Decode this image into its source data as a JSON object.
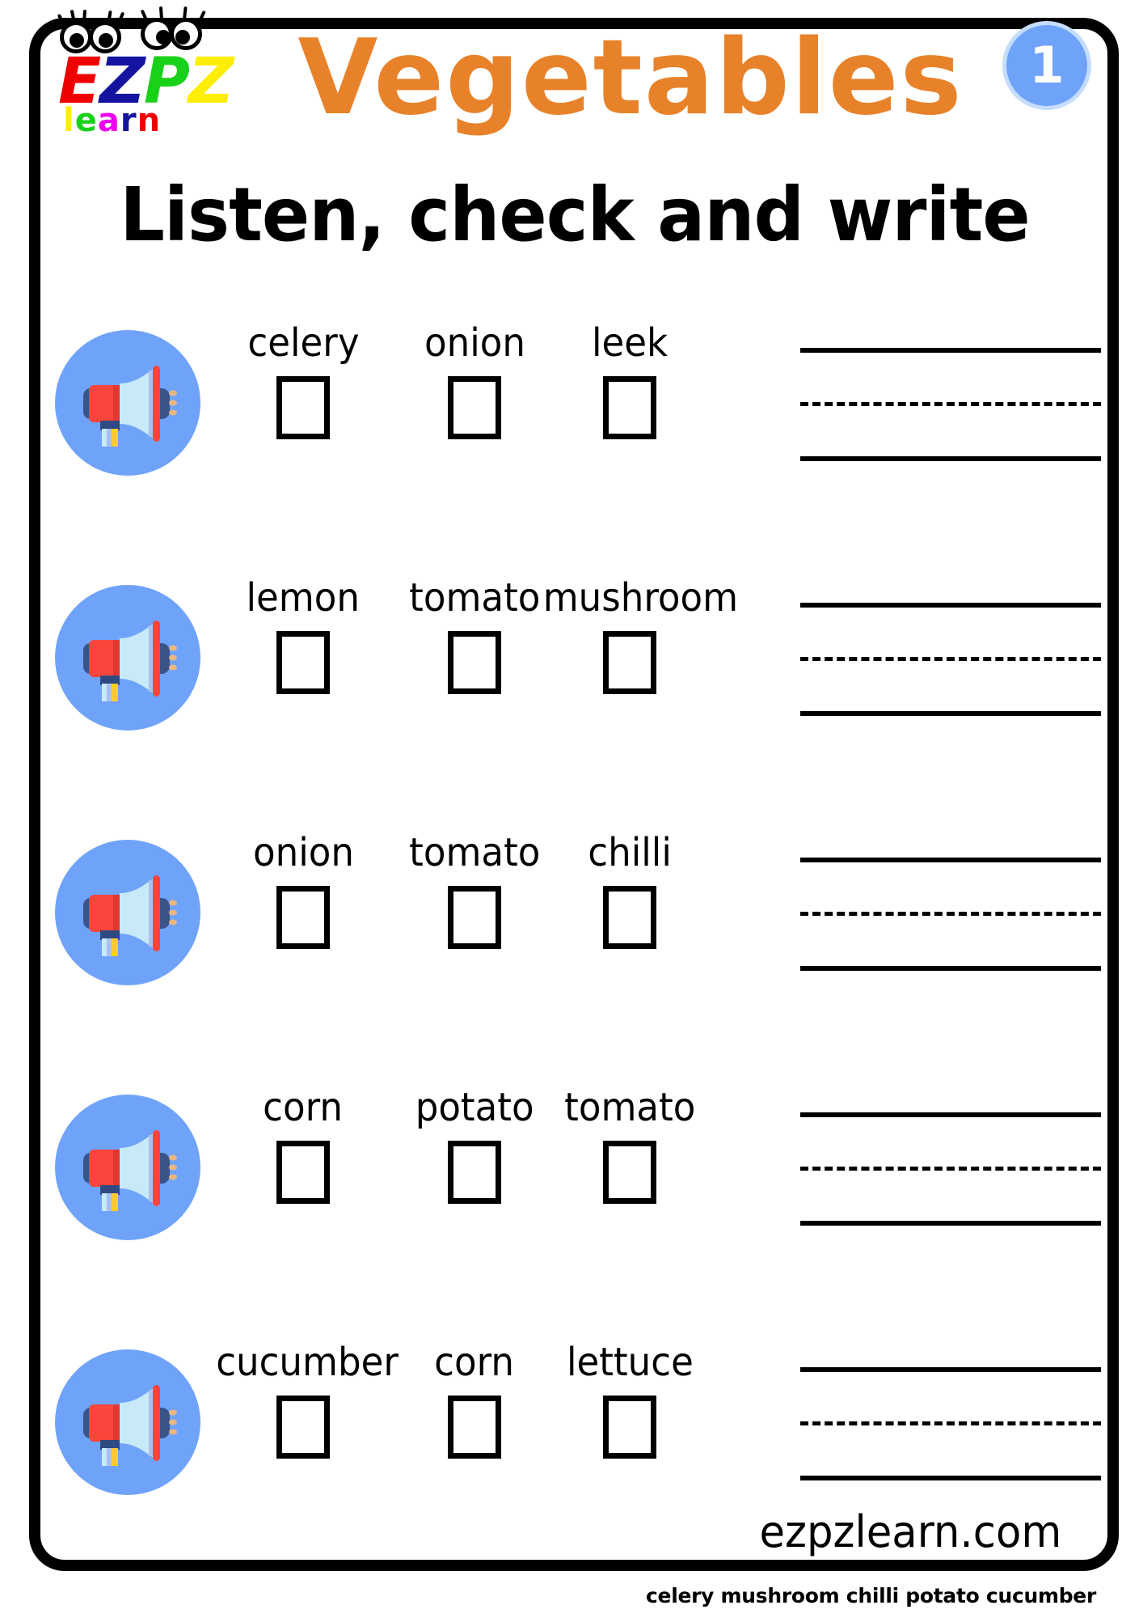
{
  "brand": {
    "logo_letters": [
      "E",
      "Z",
      "P",
      "Z"
    ],
    "logo_word": [
      "l",
      "e",
      "a",
      "r",
      "n"
    ],
    "logo_name": "EZPZ learn",
    "site": "ezpzlearn.com"
  },
  "header": {
    "title": "Vegetables",
    "subtitle": "Listen, check and write",
    "page_number": "1",
    "title_color": "#e8822a",
    "badge_color": "#6fa3fa",
    "badge_ring_color": "#c6dcfd"
  },
  "exercise": {
    "speaker_icon": "megaphone-icon",
    "rows": [
      {
        "options": [
          "celery",
          "onion",
          "leek"
        ]
      },
      {
        "options": [
          "lemon",
          "tomato",
          "mushroom"
        ]
      },
      {
        "options": [
          "onion",
          "tomato",
          "chilli"
        ]
      },
      {
        "options": [
          "corn",
          "potato",
          "tomato"
        ]
      },
      {
        "options": [
          "cucumber",
          "corn",
          "lettuce"
        ]
      }
    ]
  },
  "footer": {
    "answer_key": "celery mushroom chilli potato cucumber"
  }
}
